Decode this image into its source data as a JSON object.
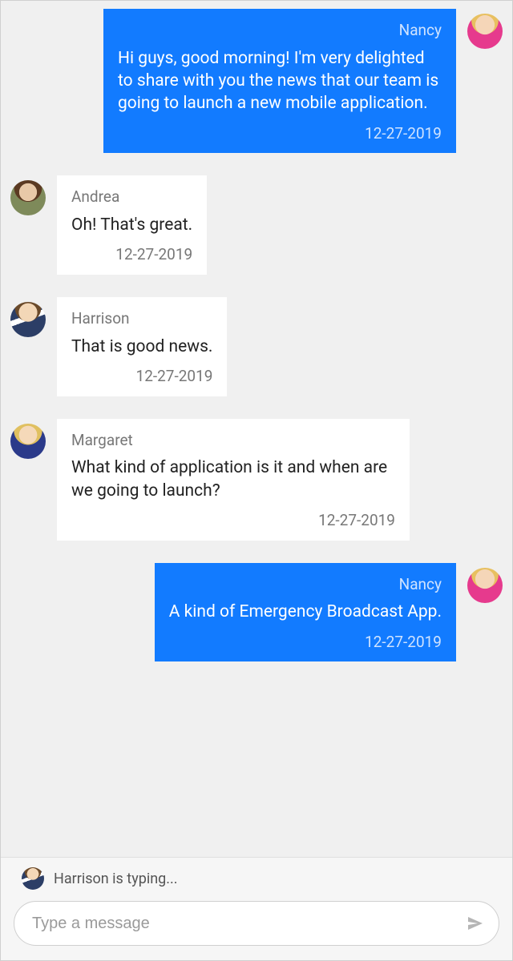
{
  "messages": [
    {
      "side": "right",
      "avatar": "nancy",
      "sender": "Nancy",
      "text": "Hi guys, good morning! I'm very delighted to share with you the news that our team is going to launch a new mobile application.",
      "time": "12-27-2019",
      "bubble": "blue"
    },
    {
      "side": "left",
      "avatar": "andrea",
      "sender": "Andrea",
      "text": "Oh! That's great.",
      "time": "12-27-2019",
      "bubble": "white"
    },
    {
      "side": "left",
      "avatar": "harrison",
      "sender": "Harrison",
      "text": "That is good news.",
      "time": "12-27-2019",
      "bubble": "white"
    },
    {
      "side": "left",
      "avatar": "margaret",
      "sender": "Margaret",
      "text": "What kind of application is it and when are we going to launch?",
      "time": "12-27-2019",
      "bubble": "white"
    },
    {
      "side": "right",
      "avatar": "nancy",
      "sender": "Nancy",
      "text": "A kind of Emergency Broadcast App.",
      "time": "12-27-2019",
      "bubble": "blue"
    }
  ],
  "typing": {
    "avatar": "harrison",
    "text": "Harrison is typing..."
  },
  "input": {
    "placeholder": "Type a message"
  }
}
